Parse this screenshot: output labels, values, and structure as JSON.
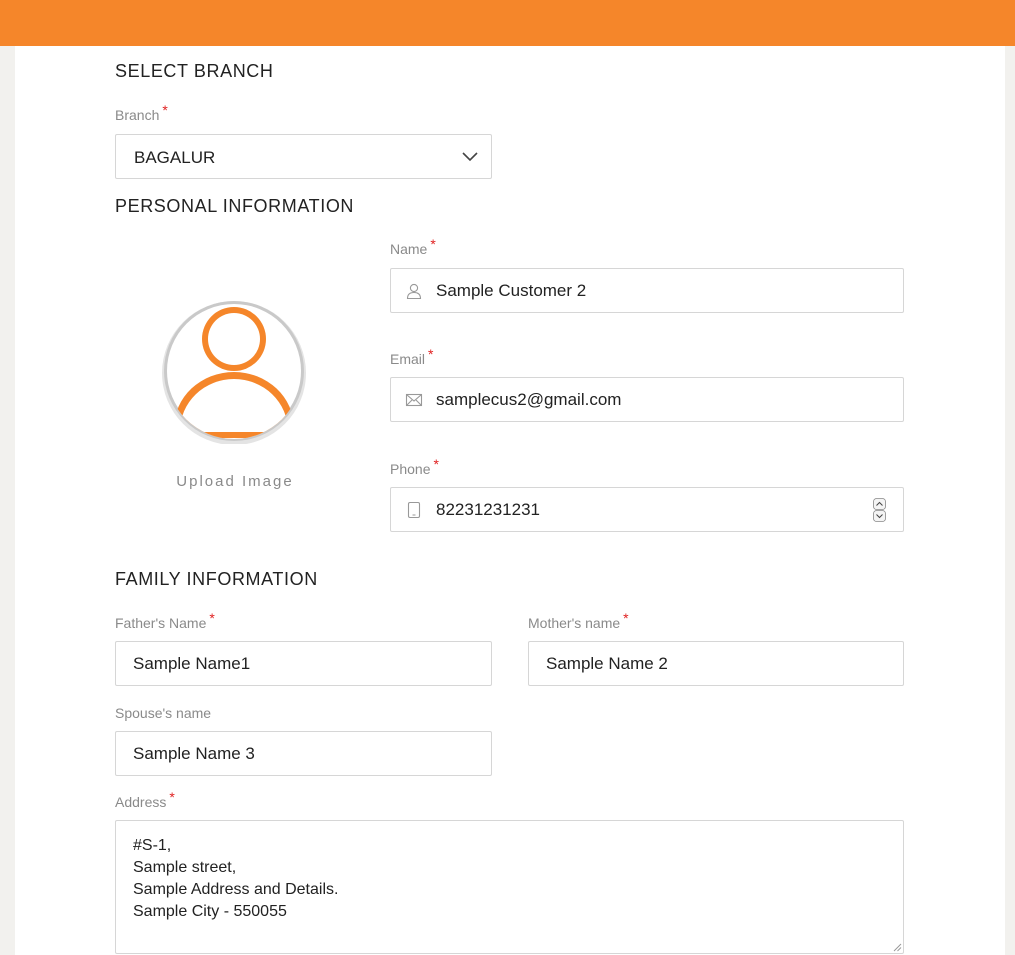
{
  "colors": {
    "accent": "#f5862a",
    "required": "#e02020",
    "border": "#d6d6d6"
  },
  "sections": {
    "branch_title": "SELECT BRANCH",
    "personal_title": "PERSONAL INFORMATION",
    "family_title": "FAMILY INFORMATION"
  },
  "branch": {
    "label": "Branch",
    "value": "BAGALUR"
  },
  "personal": {
    "upload_label": "Upload Image",
    "name": {
      "label": "Name",
      "value": "Sample Customer 2",
      "icon": "user-icon"
    },
    "email": {
      "label": "Email",
      "value": "samplecus2@gmail.com",
      "icon": "envelope-icon"
    },
    "phone": {
      "label": "Phone",
      "value": "82231231231",
      "icon": "phone-icon"
    }
  },
  "family": {
    "father": {
      "label": "Father's Name",
      "value": "Sample Name1"
    },
    "mother": {
      "label": "Mother's name",
      "value": "Sample Name 2"
    },
    "spouse": {
      "label": "Spouse's name",
      "value": "Sample Name 3"
    },
    "address": {
      "label": "Address",
      "value": "#S-1,\nSample street,\nSample Address and Details.\nSample City - 550055"
    }
  },
  "required_mark": "*"
}
